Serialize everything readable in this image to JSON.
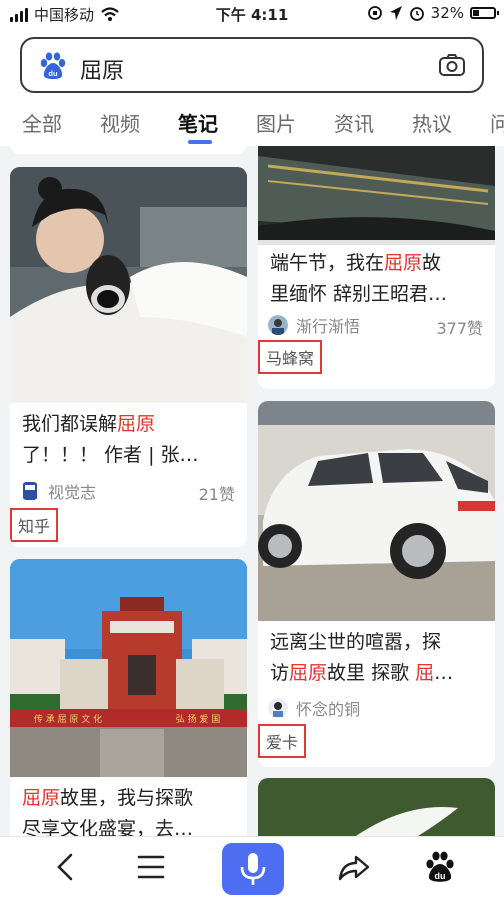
{
  "status_bar": {
    "carrier": "中国移动",
    "time": "下午 4:11",
    "battery": "32%",
    "battery_level": 0.32
  },
  "search": {
    "query": "屈原"
  },
  "tabs": [
    {
      "label": "全部"
    },
    {
      "label": "视频"
    },
    {
      "label": "笔记"
    },
    {
      "label": "图片"
    },
    {
      "label": "资讯"
    },
    {
      "label": "热议"
    },
    {
      "label": "问"
    }
  ],
  "active_tab": "笔记",
  "cards": {
    "left1": {
      "title_a": "我们都误解",
      "title_hl": "屈原",
      "title_b": "了！！！ 作者 | 张…",
      "author": "视觉志",
      "likes": "21赞",
      "tag": "知乎"
    },
    "left2": {
      "title_hl": "屈原",
      "title_a": "故里，我与探歌",
      "title_b": "尽享文化盛宴，去…",
      "sign_left": "传 承 屈 原 文 化",
      "sign_right": "弘 扬 爱 国"
    },
    "right1": {
      "title_a": "端午节，我在",
      "title_hl": "屈原",
      "title_b": "故",
      "title_c": "里缅怀 辞别王昭君…",
      "author": "渐行渐悟",
      "likes": "377赞",
      "tag": "马蜂窝"
    },
    "right2": {
      "title_a": "远离尘世的喧嚣，探",
      "title_b": "访",
      "title_hl": "屈原",
      "title_c": "故里 探歌 ",
      "title_hl2": "屈",
      "title_d": "…",
      "author": "怀念的铜",
      "tag": "爱卡"
    }
  }
}
